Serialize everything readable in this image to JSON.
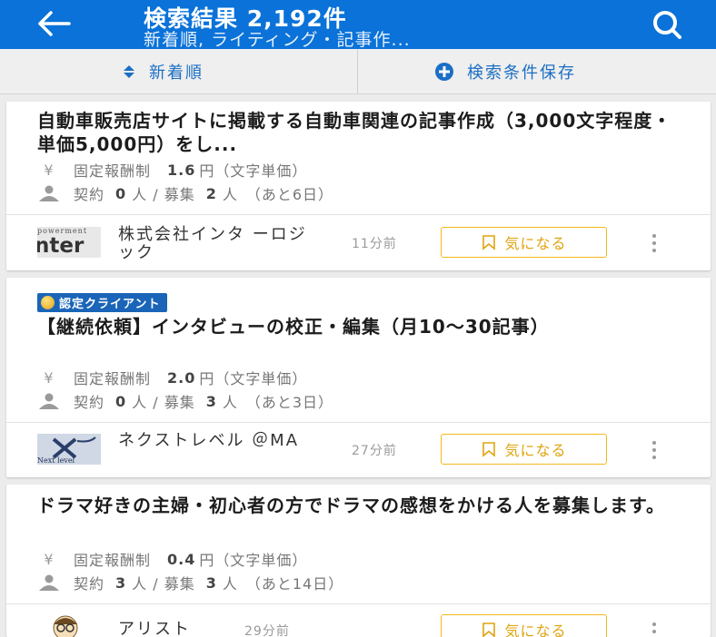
{
  "header": {
    "title": "検索結果 2,192件",
    "subtitle": "新着順, ライティング・記事作..."
  },
  "toolbar": {
    "sort_label": "新着順",
    "save_label": "検索条件保存"
  },
  "jobs": [
    {
      "title": "自動車販売店サイトに掲載する自動車関連の記事作成（3,000文字程度・単価5,000円）をし...",
      "pay_type": "固定報酬制",
      "price": "1.6",
      "price_unit": "円（文字単価）",
      "contract_label": "契約",
      "contract_count": "0",
      "recruit_label": "人 / 募集",
      "recruit_count": "2",
      "remaining": "人　（あと6日）",
      "client_name": "株式会社インタ ーロジック",
      "posted": "11分前",
      "favorite_label": "気になる",
      "certified_badge": ""
    },
    {
      "title": "【継続依頼】インタビューの校正・編集（月10〜30記事）",
      "pay_type": "固定報酬制",
      "price": "2.0",
      "price_unit": "円（文字単価）",
      "contract_label": "契約",
      "contract_count": "0",
      "recruit_label": "人 / 募集",
      "recruit_count": "3",
      "remaining": "人　（あと3日）",
      "client_name": "ネクストレベル ＠MA",
      "posted": "27分前",
      "favorite_label": "気になる",
      "certified_badge": "認定クライアント"
    },
    {
      "title": "ドラマ好きの主婦・初心者の方でドラマの感想をかける人を募集します。",
      "pay_type": "固定報酬制",
      "price": "0.4",
      "price_unit": "円（文字単価）",
      "contract_label": "契約",
      "contract_count": "3",
      "recruit_label": "人 / 募集",
      "recruit_count": "3",
      "remaining": "人　（あと14日）",
      "client_name": "アリスト",
      "posted": "29分前",
      "favorite_label": "気になる",
      "certified_badge": ""
    }
  ],
  "logo_text": {
    "interlogic_top": "powerment",
    "interlogic_main": "nter",
    "nextlevel": "Next level"
  },
  "colors": {
    "header_bg": "#0a72d8",
    "accent_blue": "#1b6fc4",
    "favorite_yellow": "#f2b81c",
    "badge_blue": "#1a65b8"
  },
  "icons": {
    "back": "arrow-left-icon",
    "search": "search-icon",
    "sort": "sort-updown-icon",
    "save": "plus-circle-icon",
    "yen": "yen-icon",
    "person": "person-icon",
    "bookmark": "bookmark-icon",
    "more": "more-vertical-icon",
    "medal": "medal-icon"
  }
}
